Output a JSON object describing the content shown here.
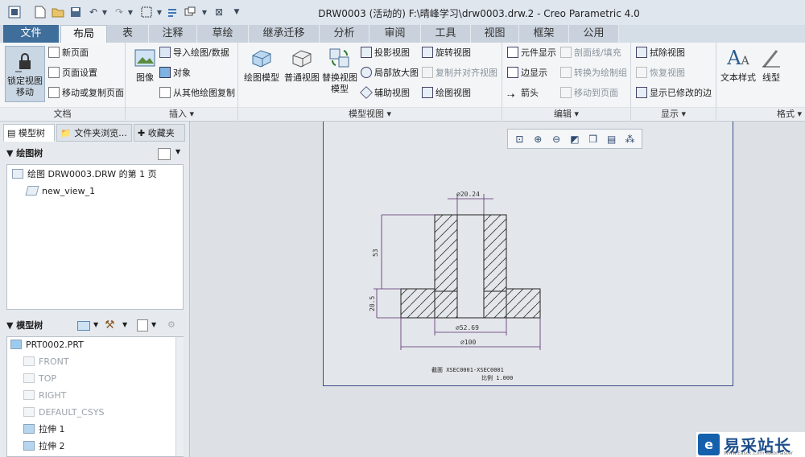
{
  "window": {
    "title": "DRW0003 (活动的) F:\\晴峰学习\\drw0003.drw.2 - Creo Parametric 4.0"
  },
  "tabs": [
    "文件",
    "布局",
    "表",
    "注释",
    "草绘",
    "继承迁移",
    "分析",
    "审阅",
    "工具",
    "视图",
    "框架",
    "公用"
  ],
  "ribbon": {
    "doc": {
      "lock_view": "锁定视图\n移动",
      "new_page": "新页面",
      "page_setup": "页面设置",
      "move_copy_page": "移动或复制页面",
      "label": "文档"
    },
    "insert": {
      "image": "图像",
      "import": "导入绘图/数据",
      "object": "对象",
      "copy_from": "从其他绘图复制",
      "label": "插入"
    },
    "model_views": {
      "general": "绘图模型",
      "normal": "普通视图",
      "replace": "替换视图\n模型",
      "projection": "投影视图",
      "detail": "局部放大图",
      "auxiliary": "辅助视图",
      "revolved": "旋转视图",
      "copy_align": "复制并对齐视图",
      "drawing_view": "绘图视图",
      "label": "模型视图"
    },
    "edit": {
      "component_display": "元件显示",
      "hatch": "剖面线/填充",
      "edge_display": "边显示",
      "convert_group": "转换为绘制组",
      "arrow": "箭头",
      "move_to_page": "移动到页面",
      "label": "编辑"
    },
    "display": {
      "erase": "拭除视图",
      "restore": "恢复视图",
      "show_modified": "显示已修改的边",
      "label": "显示"
    },
    "format": {
      "text_style": "文本样式",
      "line_style": "线型",
      "label": "格式"
    }
  },
  "left_panel": {
    "tabs": [
      "模型树",
      "文件夹浏览...",
      "收藏夹"
    ],
    "drawing_tree": {
      "header": "绘图树",
      "items": [
        "绘图 DRW0003.DRW 的第 1 页",
        "new_view_1"
      ]
    },
    "model_tree": {
      "header": "模型树",
      "items": [
        "PRT0002.PRT",
        "FRONT",
        "TOP",
        "RIGHT",
        "DEFAULT_CSYS",
        "拉伸 1",
        "拉伸 2"
      ]
    }
  },
  "drawing": {
    "dims": {
      "top_dia": "⌀20.24",
      "height": "53",
      "flange": "20.5",
      "mid_dia": "⌀52.69",
      "outer_dia": "⌀100"
    },
    "section_label": "截面  XSEC0001-XSEC0001",
    "scale_label": "比例  1.000"
  },
  "watermark": {
    "title": "易采站长站",
    "sub": "Www.Easck.Com  Webmaster"
  }
}
